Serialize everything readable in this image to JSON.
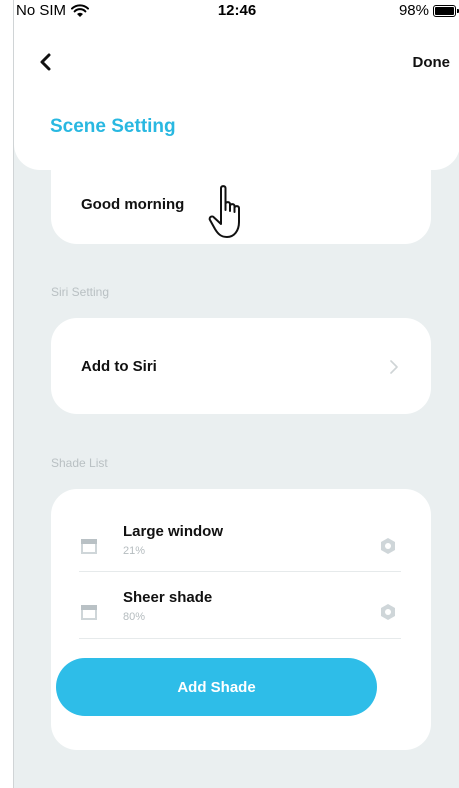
{
  "status_bar": {
    "carrier": "No SIM",
    "time": "12:46",
    "battery": "98%"
  },
  "header": {
    "done_label": "Done",
    "title": "Scene Setting"
  },
  "scene": {
    "name": "Good morning"
  },
  "siri": {
    "section_label": "Siri Setting",
    "add_label": "Add to Siri"
  },
  "shades": {
    "section_label": "Shade List",
    "items": [
      {
        "name": "Large window",
        "percent": "21%"
      },
      {
        "name": "Sheer shade",
        "percent": "80%"
      }
    ],
    "add_button_label": "Add Shade"
  },
  "colors": {
    "accent": "#2ebde8",
    "title": "#29b8e1",
    "background": "#eaeff0"
  },
  "icons": {
    "back": "chevron-left-icon",
    "shade": "shade-icon",
    "settings": "hexagon-settings-icon",
    "pointer": "hand-pointer-icon"
  }
}
